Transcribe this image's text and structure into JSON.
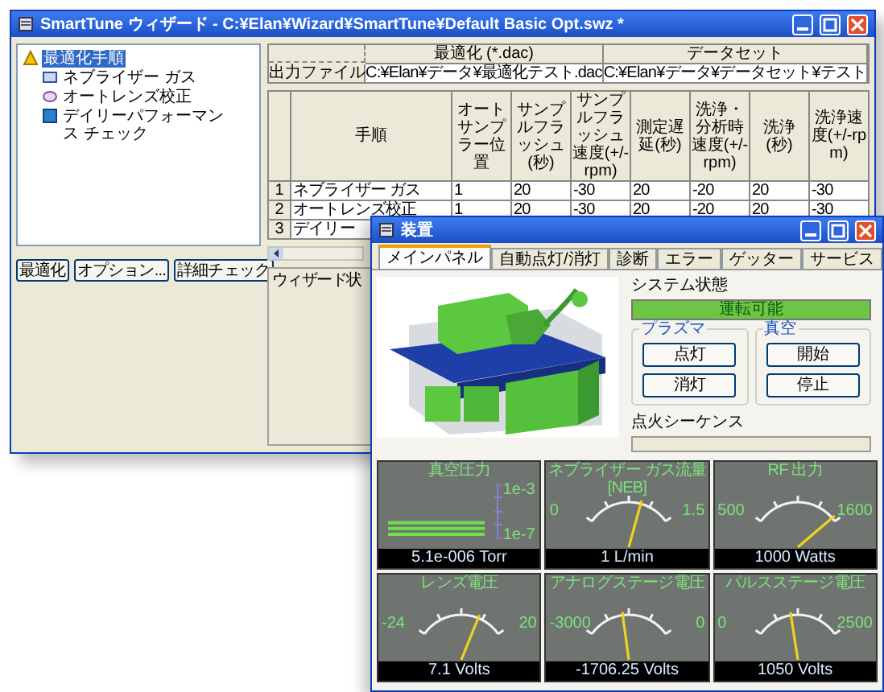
{
  "back_window": {
    "title": "SmartTune ウィザード - C:¥Elan¥Wizard¥SmartTune¥Default Basic Opt.swz *",
    "tree": [
      {
        "label": "最適化手順",
        "selected": true,
        "children": [
          {
            "label": "ネブライザー ガス",
            "selected": false
          },
          {
            "label": "オートレンズ校正",
            "selected": false
          },
          {
            "label": "デイリーパフォーマンス チェック",
            "selected": false
          }
        ]
      }
    ],
    "buttons": [
      "最適化",
      "オプション...",
      "詳細チェック"
    ],
    "files": {
      "columns": [
        "最適化 (*.dac)",
        "データセット"
      ],
      "row_label": "出力ファイル",
      "values": [
        "C:¥Elan¥データ¥最適化テスト.dac",
        "C:¥Elan¥データ¥データセット¥テスト"
      ]
    },
    "table": {
      "columns": [
        "手順",
        "オートサンプラー位置",
        "サンプルフラッシュ(秒)",
        "サンプルフラッシュ速度(+/-rpm)",
        "測定遅延(秒)",
        "洗浄・分析時速度(+/-rpm)",
        "洗浄(秒)",
        "洗浄速度(+/-rpm)"
      ],
      "rows": [
        {
          "number": "1",
          "cells": [
            "ネブライザー ガス",
            "1",
            "20",
            "-30",
            "20",
            "-20",
            "20",
            "-30"
          ]
        },
        {
          "number": "2",
          "cells": [
            "オートレンズ校正",
            "1",
            "20",
            "-30",
            "20",
            "-20",
            "20",
            "-30"
          ]
        },
        {
          "number": "3",
          "cells": [
            "デイリー"
          ]
        }
      ]
    },
    "status_label": "ウィザード状"
  },
  "front_window": {
    "title": "装置",
    "tabs": [
      {
        "label": "メインパネル",
        "selected": true
      },
      {
        "label": "自動点灯/消灯",
        "selected": false
      },
      {
        "label": "診断",
        "selected": false
      },
      {
        "label": "エラー",
        "selected": false
      },
      {
        "label": "ゲッター",
        "selected": false
      },
      {
        "label": "サービス",
        "selected": false
      }
    ],
    "system_status": {
      "label": "システム状態",
      "value": "運転可能"
    },
    "groups": [
      {
        "title": "プラズマ",
        "buttons": [
          "点灯",
          "消灯"
        ]
      },
      {
        "title": "真空",
        "buttons": [
          "開始",
          "停止"
        ]
      }
    ],
    "ignition": {
      "label": "点火シーケンス"
    },
    "gauges": [
      {
        "kind": "bar",
        "title": "真空圧力",
        "max_label": "1e-3",
        "min_label": "1e-7",
        "reading": "5.1e-006 Torr"
      },
      {
        "kind": "dial",
        "title": "ネブライザー ガス流量 [NEB]",
        "min_label": "0",
        "max_label": "1.5",
        "reading": "1 L/min"
      },
      {
        "kind": "dial",
        "title": "RF 出力",
        "min_label": "500",
        "max_label": "1600",
        "reading": "1000 Watts"
      },
      {
        "kind": "dial",
        "title": "レンズ電圧",
        "min_label": "-24",
        "max_label": "20",
        "reading": "7.1 Volts"
      },
      {
        "kind": "dial",
        "title": "アナログステージ電圧",
        "min_label": "-3000",
        "max_label": "0",
        "reading": "-1706.25 Volts"
      },
      {
        "kind": "dial",
        "title": "パルスステージ電圧",
        "min_label": "0",
        "max_label": "2500",
        "reading": "1050 Volts"
      }
    ]
  }
}
